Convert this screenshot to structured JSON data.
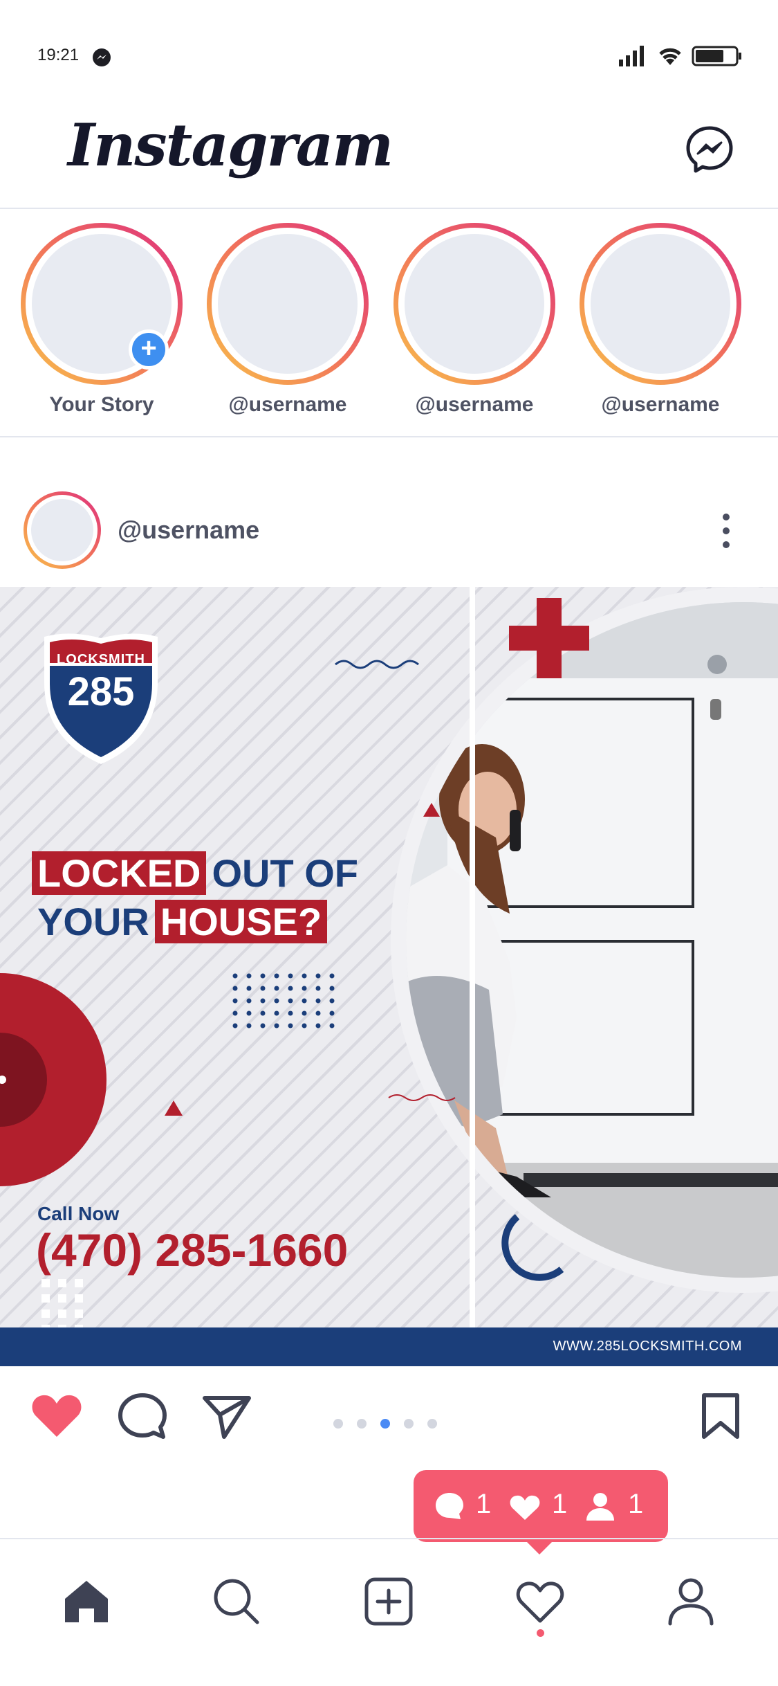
{
  "status_bar": {
    "time": "19:21",
    "icons": [
      "messenger-icon",
      "signal-icon",
      "wifi-icon",
      "battery-icon"
    ]
  },
  "header": {
    "app_name": "Instagram",
    "messenger_icon": "messenger-icon"
  },
  "stories": [
    {
      "label": "Your Story",
      "has_add": true
    },
    {
      "label": "@username",
      "has_add": false
    },
    {
      "label": "@username",
      "has_add": false
    },
    {
      "label": "@username",
      "has_add": false
    }
  ],
  "post": {
    "username": "@username",
    "ad": {
      "logo_top": "LOCKSMITH",
      "logo_number": "285",
      "headline_red_1": "LOCKED",
      "headline_blue_1": "OUT OF",
      "headline_blue_2": "YOUR",
      "headline_red_2": "HOUSE?",
      "call_now": "Call Now",
      "phone": "(470) 285-1660",
      "website": "WWW.285LOCKSMITH.COM"
    },
    "pager": {
      "count": 5,
      "active_index": 2
    }
  },
  "notification": {
    "comments": "1",
    "likes": "1",
    "followers": "1"
  },
  "bottom_nav": [
    "home-icon",
    "search-icon",
    "add-post-icon",
    "activity-heart-icon",
    "profile-icon"
  ],
  "colors": {
    "like_red": "#f45a70",
    "brand_blue": "#1b3e7a",
    "brand_red": "#b21f2d",
    "pager_active": "#4a8af4"
  }
}
